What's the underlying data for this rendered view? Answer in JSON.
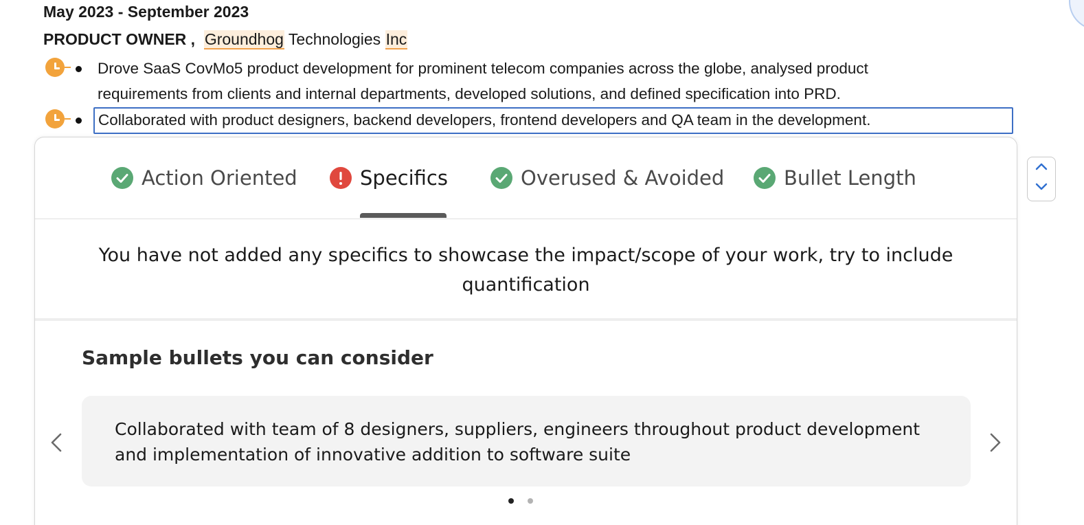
{
  "experience": {
    "date_range": "May 2023 - September 2023",
    "role": "PRODUCT OWNER ,",
    "company_part1": "Groundhog",
    "company_part2": "Technologies",
    "company_part3": "Inc",
    "bullets": [
      {
        "line1": "Drove SaaS CovMo5 product development  for prominent telecom companies across the globe, analysed product",
        "line2": "requirements from clients and internal departments, developed solutions, and defined specification into PRD."
      },
      {
        "line1": "Collaborated with product designers, backend developers, frontend developers and QA team in the development."
      }
    ]
  },
  "feedback_panel": {
    "tabs": [
      {
        "label": "Action Oriented",
        "status": "pass",
        "icon": "check-circle-icon"
      },
      {
        "label": "Specifics",
        "status": "fail",
        "icon": "exclamation-circle-icon"
      },
      {
        "label": "Overused & Avoided",
        "status": "pass",
        "icon": "check-circle-icon"
      },
      {
        "label": "Bullet Length",
        "status": "pass",
        "icon": "check-circle-icon"
      }
    ],
    "active_tab": "Specifics",
    "message": "You have not added any specifics to showcase the impact/scope of your work, try to include quantification",
    "samples_title": "Sample bullets you can consider",
    "sample_text": "Collaborated with team of 8 designers, suppliers, engineers throughout product development and implementation of innovative addition to software suite",
    "carousel": {
      "total_pages": 2,
      "current_page": 1
    }
  },
  "colors": {
    "pass": "#5aa874",
    "fail": "#e0483e",
    "warning_badge": "#f2a33c",
    "selection_border": "#3d6fc4",
    "stepper_arrow": "#2f6fd0"
  },
  "icons": {
    "clock": "clock-badge-icon",
    "prev": "chevron-left-icon",
    "next": "chevron-right-icon",
    "up": "chevron-up-icon",
    "down": "chevron-down-icon"
  }
}
